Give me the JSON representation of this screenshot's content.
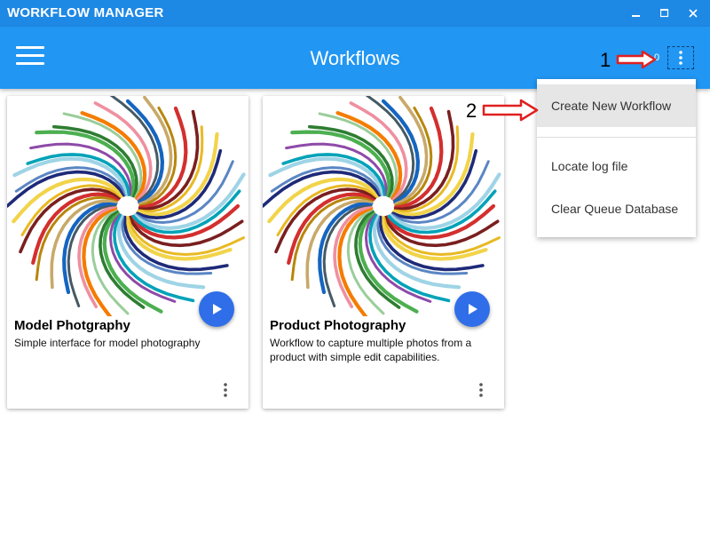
{
  "window": {
    "title": "WORKFLOW MANAGER"
  },
  "appbar": {
    "title": "Workflows",
    "notification_count": "0"
  },
  "annotations": {
    "step1": "1",
    "step2": "2",
    "arrow_color": "#e02020"
  },
  "menu": {
    "items": [
      {
        "label": "Create New Workflow"
      },
      {
        "label": "Locate log file"
      },
      {
        "label": "Clear Queue Database"
      }
    ]
  },
  "cards": [
    {
      "title": "Model Photgraphy",
      "description": "Simple interface for model photography"
    },
    {
      "title": "Product Photography",
      "description": "Workflow to capture multiple photos from a product with simple edit capabilities."
    }
  ],
  "colors": {
    "titlebar": "#1e88e5",
    "appbar": "#2196f3",
    "play_button": "#2f6ee8",
    "spiral": [
      "#d32f2f",
      "#7a1f1f",
      "#e8b923",
      "#f2d44a",
      "#1e2a78",
      "#5a86c4",
      "#9fd4e6",
      "#00a2b8",
      "#8e4aa8",
      "#4caf50",
      "#2e7d32",
      "#9acd9a",
      "#f57c00",
      "#ef8fa0",
      "#455a64",
      "#1565c0",
      "#c8a96a",
      "#b8860b"
    ]
  }
}
